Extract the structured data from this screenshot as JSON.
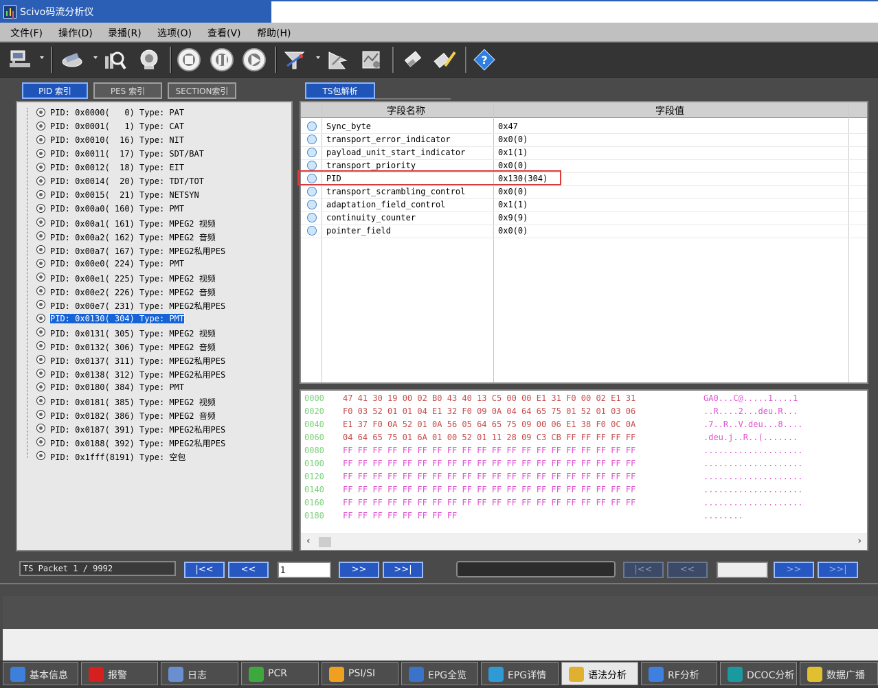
{
  "window": {
    "title": "Scivo码流分析仪"
  },
  "menu": [
    "文件(F)",
    "操作(D)",
    "录播(R)",
    "选项(O)",
    "查看(V)",
    "帮助(H)"
  ],
  "toolbar": {
    "buttons": [
      "network-icon",
      "tools-icon",
      "search-chart-icon",
      "record-icon",
      "stop-icon",
      "pause-icon",
      "play-icon",
      "filter-icon",
      "analysis-icon",
      "map-icon",
      "eraser-icon",
      "edit-icon",
      "help-icon"
    ]
  },
  "left_tabs": [
    "PID 索引",
    "PES 索引",
    "SECTION索引"
  ],
  "right_tabs": [
    "TS包解析"
  ],
  "pid_tree": [
    "PID: 0x0000(   0) Type: PAT",
    "PID: 0x0001(   1) Type: CAT",
    "PID: 0x0010(  16) Type: NIT",
    "PID: 0x0011(  17) Type: SDT/BAT",
    "PID: 0x0012(  18) Type: EIT",
    "PID: 0x0014(  20) Type: TDT/TOT",
    "PID: 0x0015(  21) Type: NETSYN",
    "PID: 0x00a0( 160) Type: PMT",
    "PID: 0x00a1( 161) Type: MPEG2 视频",
    "PID: 0x00a2( 162) Type: MPEG2 音频",
    "PID: 0x00a7( 167) Type: MPEG2私用PES",
    "PID: 0x00e0( 224) Type: PMT",
    "PID: 0x00e1( 225) Type: MPEG2 视频",
    "PID: 0x00e2( 226) Type: MPEG2 音频",
    "PID: 0x00e7( 231) Type: MPEG2私用PES",
    "PID: 0x0130( 304) Type: PMT",
    "PID: 0x0131( 305) Type: MPEG2 视频",
    "PID: 0x0132( 306) Type: MPEG2 音频",
    "PID: 0x0137( 311) Type: MPEG2私用PES",
    "PID: 0x0138( 312) Type: MPEG2私用PES",
    "PID: 0x0180( 384) Type: PMT",
    "PID: 0x0181( 385) Type: MPEG2 视频",
    "PID: 0x0182( 386) Type: MPEG2 音频",
    "PID: 0x0187( 391) Type: MPEG2私用PES",
    "PID: 0x0188( 392) Type: MPEG2私用PES",
    "PID: 0x1fff(8191) Type: 空包"
  ],
  "selected_pid_index": 15,
  "fields": {
    "header_name": "字段名称",
    "header_value": "字段值",
    "rows": [
      {
        "name": "Sync_byte",
        "value": "0x47"
      },
      {
        "name": "transport_error_indicator",
        "value": "0x0(0)"
      },
      {
        "name": "payload_unit_start_indicator",
        "value": "0x1(1)"
      },
      {
        "name": "transport_priority",
        "value": "0x0(0)"
      },
      {
        "name": "PID",
        "value": "0x130(304)"
      },
      {
        "name": "transport_scrambling_control",
        "value": "0x0(0)"
      },
      {
        "name": "adaptation_field_control",
        "value": "0x1(1)"
      },
      {
        "name": "continuity_counter",
        "value": "0x9(9)"
      },
      {
        "name": "pointer_field",
        "value": "0x0(0)"
      }
    ]
  },
  "hex": [
    {
      "off": "0000",
      "bytes": "47 41 30 19 00 02 B0 43 40 13 C5 00 00 E1 31 F0 00 02 E1 31",
      "ascii": "GA0...C@.....1....1"
    },
    {
      "off": "0020",
      "bytes": "F0 03 52 01 01 04 E1 32 F0 09 0A 04 64 65 75 01 52 01 03 06",
      "ascii": "..R....2...deu.R..."
    },
    {
      "off": "0040",
      "bytes": "E1 37 F0 0A 52 01 0A 56 05 64 65 75 09 00 06 E1 38 F0 0C 0A",
      "ascii": ".7..R..V.deu...8...."
    },
    {
      "off": "0060",
      "bytes": "04 64 65 75 01 6A 01 00 52 01 11 28 09 C3 CB FF FF FF FF FF",
      "ascii": ".deu.j..R..(......."
    },
    {
      "off": "0080",
      "bytes": "FF FF FF FF FF FF FF FF FF FF FF FF FF FF FF FF FF FF FF FF",
      "ascii": "...................."
    },
    {
      "off": "0100",
      "bytes": "FF FF FF FF FF FF FF FF FF FF FF FF FF FF FF FF FF FF FF FF",
      "ascii": "...................."
    },
    {
      "off": "0120",
      "bytes": "FF FF FF FF FF FF FF FF FF FF FF FF FF FF FF FF FF FF FF FF",
      "ascii": "...................."
    },
    {
      "off": "0140",
      "bytes": "FF FF FF FF FF FF FF FF FF FF FF FF FF FF FF FF FF FF FF FF",
      "ascii": "...................."
    },
    {
      "off": "0160",
      "bytes": "FF FF FF FF FF FF FF FF FF FF FF FF FF FF FF FF FF FF FF FF",
      "ascii": "...................."
    },
    {
      "off": "0180",
      "bytes": "FF FF FF FF FF FF FF FF",
      "ascii": "........"
    }
  ],
  "nav": {
    "packet_label": "TS Packet  1 / 9992",
    "first": "|<<",
    "prev": "<<",
    "next": ">>",
    "last": ">>|",
    "packet_input": "1"
  },
  "bottom_tabs": [
    {
      "label": "基本信息",
      "icon": "info-icon",
      "color": "#3d7fd9"
    },
    {
      "label": "报警",
      "icon": "alarm-icon",
      "color": "#d62020"
    },
    {
      "label": "日志",
      "icon": "log-icon",
      "color": "#6a8fd0"
    },
    {
      "label": "PCR",
      "icon": "clock-icon",
      "color": "#3ea83e"
    },
    {
      "label": "PSI/SI",
      "icon": "folder-icon",
      "color": "#f0a020"
    },
    {
      "label": "EPG全览",
      "icon": "epg-icon",
      "color": "#3a73c8"
    },
    {
      "label": "EPG详情",
      "icon": "epg-detail-icon",
      "color": "#2f9ad4"
    },
    {
      "label": "语法分析",
      "icon": "syntax-icon",
      "color": "#e0b030"
    },
    {
      "label": "RF分析",
      "icon": "rf-icon",
      "color": "#3f7fe0"
    },
    {
      "label": "DCOC分析",
      "icon": "dcoc-icon",
      "color": "#1a9aa0"
    },
    {
      "label": "数据广播",
      "icon": "broadcast-icon",
      "color": "#e0c030"
    }
  ],
  "active_bottom_tab": 7
}
